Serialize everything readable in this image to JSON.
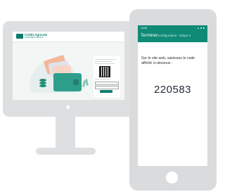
{
  "desktop": {
    "logo": {
      "name": "Crédit Agricole",
      "subtitle": "CONSUMER FINANCE"
    }
  },
  "phone": {
    "status": {
      "time": "16:00",
      "icons": "▲ ■ ■"
    },
    "appbar": {
      "close_label": "Terminer",
      "subtitle": "Configuration - Étape 2"
    },
    "instruction": "Sur le site web, saisissez le code affiché ci-dessous :",
    "code": "220583"
  },
  "colors": {
    "brand": "#0f8a76",
    "device_frame": "#dedfe1"
  }
}
